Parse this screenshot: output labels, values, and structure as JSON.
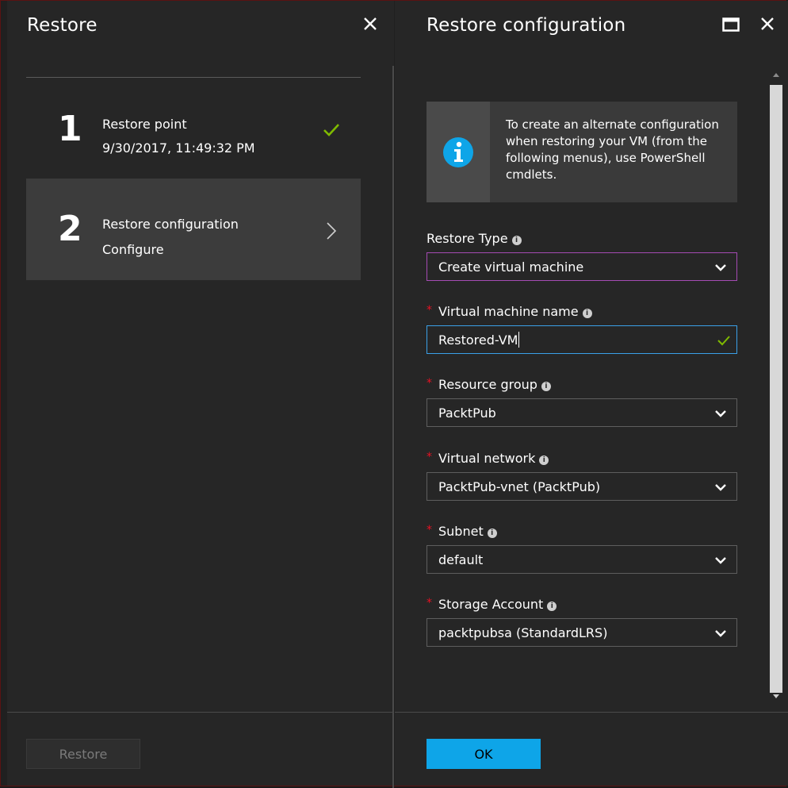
{
  "left_blade": {
    "title": "Restore",
    "steps": [
      {
        "number": "1",
        "title": "Restore point",
        "subtitle": "9/30/2017, 11:49:32 PM",
        "status": "completed"
      },
      {
        "number": "2",
        "title": "Restore configuration",
        "subtitle": "Configure",
        "status": "active"
      }
    ],
    "restore_button": "Restore"
  },
  "right_blade": {
    "title": "Restore configuration",
    "info_text": "To create an alternate configuration when restoring your VM (from the following menus), use PowerShell cmdlets.",
    "fields": {
      "restore_type": {
        "label": "Restore Type",
        "value": "Create virtual machine"
      },
      "vm_name": {
        "label": "Virtual machine name",
        "value": "Restored-VM"
      },
      "resource_group": {
        "label": "Resource group",
        "value": "PacktPub"
      },
      "virtual_network": {
        "label": "Virtual network",
        "value": "PacktPub-vnet (PacktPub)"
      },
      "subnet": {
        "label": "Subnet",
        "value": "default"
      },
      "storage_account": {
        "label": "Storage Account",
        "value": "packtpubsa (StandardLRS)"
      }
    },
    "ok_button": "OK"
  },
  "colors": {
    "accent": "#0ea5e8",
    "success": "#7fba00",
    "required": "#e81123",
    "focus_purple": "#a54bb3",
    "focus_blue": "#3aa0e8"
  },
  "icons": {
    "close": "close-icon",
    "maximize": "maximize-icon",
    "check": "checkmark-icon",
    "chevron_right": "chevron-right-icon",
    "chevron_down": "chevron-down-icon",
    "info": "info-icon"
  }
}
